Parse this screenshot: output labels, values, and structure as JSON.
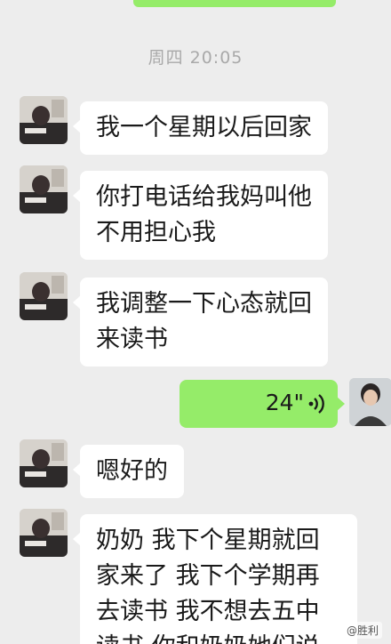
{
  "timestamp": "周四 20:05",
  "messages": [
    {
      "lines": [
        "我一个星期以后回家"
      ]
    },
    {
      "lines": [
        "你打电话给我妈叫他",
        "不用担心我"
      ]
    },
    {
      "lines": [
        "我调整一下心态就回",
        "来读书"
      ]
    },
    {
      "voice_duration": "24\""
    },
    {
      "lines": [
        "嗯好的"
      ]
    },
    {
      "lines": [
        "奶奶 我下个星期就回",
        "家来了 我下个学期再",
        "去读书 我不想去五中",
        "读书 你和奶奶她们说"
      ]
    }
  ],
  "watermark": "@胜利",
  "colors": {
    "background": "#ededed",
    "received_bubble": "#ffffff",
    "sent_bubble": "#95ec69",
    "timestamp_text": "#a9a9a9"
  }
}
